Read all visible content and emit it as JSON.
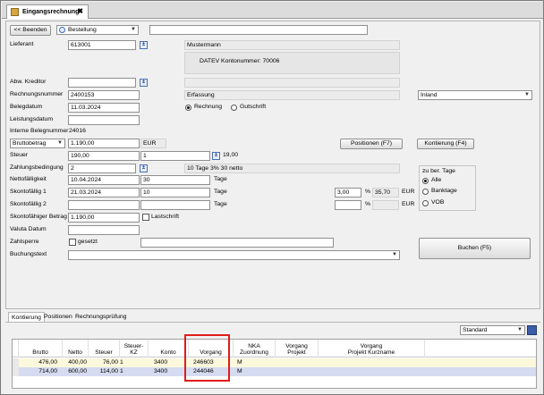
{
  "tab": {
    "title": "Eingangsrechnung",
    "close": "✖"
  },
  "toolbar": {
    "back_label": "<< Beenden",
    "mode_value": "Bestellung"
  },
  "form": {
    "lieferant_label": "Lieferant",
    "lieferant_value": "613001",
    "lieferant_name": "Mustermann",
    "datev_text": "DATEV Kontonummer: 70006",
    "abw_kreditor_label": "Abw. Kreditor",
    "rechnungsnummer_label": "Rechnungsnummer",
    "rechnungsnummer_value": "2400153",
    "erfassung_label": "Erfassung",
    "region_value": "Inland",
    "belegdatum_label": "Belegdatum",
    "belegdatum_value": "11.03.2024",
    "radio_rechnung": "Rechnung",
    "radio_gutschrift": "Gutschrift",
    "leistungsdatum_label": "Leistungsdatum",
    "interne_label": "Interne Belegnummer",
    "interne_value": "24016",
    "betragsart_value": "Bruttobetrag",
    "betrag_value": "1.190,00",
    "currency": "EUR",
    "positionen_button": "Positionen (F7)",
    "kontierung_button": "Kontierung (F4)",
    "steuer_label": "Steuer",
    "steuer_value": "190,00",
    "steuer_code": "1",
    "steuer_rate": "19,00",
    "zahlungsbedingung_label": "Zahlungsbedingung",
    "zahlungsbedingung_value": "2",
    "zahlungsbedingung_text": "10 Tage 3% 30 netto",
    "netto_faellig_label": "Nettofälligkeit",
    "netto_faellig_value": "10.04.2024",
    "netto_faellig_days": "30",
    "tage": "Tage",
    "skonto1_label": "Skontofällig 1",
    "skonto1_value": "21.03.2024",
    "skonto1_days": "10",
    "skonto1_percent": "3,00",
    "percent_sign": "%",
    "skonto1_amount": "35,70",
    "skonto2_label": "Skontofällig 2",
    "skontofaehig_label": "Skontofähiger Betrag",
    "skontofaehig_value": "1.190,00",
    "lastschrift_label": "Lastschrift",
    "valuta_label": "Valuta Datum",
    "zahlsperre_label": "Zahlsperre",
    "gesetzt_label": "gesetzt",
    "buchungstext_label": "Buchungstext",
    "ber_tage_title": "zu ber. Tage",
    "opt_alle": "Alle",
    "opt_banktage": "Banktage",
    "opt_vob": "VOB",
    "buchen_button": "Buchen (F5)"
  },
  "lower_tabs": [
    "Kontierung",
    "Positionen",
    "Rechnungsprüfung"
  ],
  "layout_select": "Standard",
  "table": {
    "headers": [
      "Brutto",
      "Netto",
      "Steuer",
      "Steuer-\nKZ",
      "Konto",
      "Vorgang",
      "NKA\nZuordnung",
      "Vorgang\nProjekt",
      "Vorgang\nProjekt Kurzname"
    ],
    "rows": [
      {
        "brutto": "476,00",
        "netto": "400,00",
        "steuer": "76,00",
        "kz": "1",
        "konto": "3400",
        "vorgang": "246603",
        "nka": "M"
      },
      {
        "brutto": "714,00",
        "netto": "600,00",
        "steuer": "114,00",
        "kz": "1",
        "konto": "3400",
        "vorgang": "244046",
        "nka": "M"
      }
    ]
  },
  "colors": {
    "row1": "#fbf8dc",
    "row2": "#d5dbf0",
    "highlight": "#e01b1b"
  }
}
